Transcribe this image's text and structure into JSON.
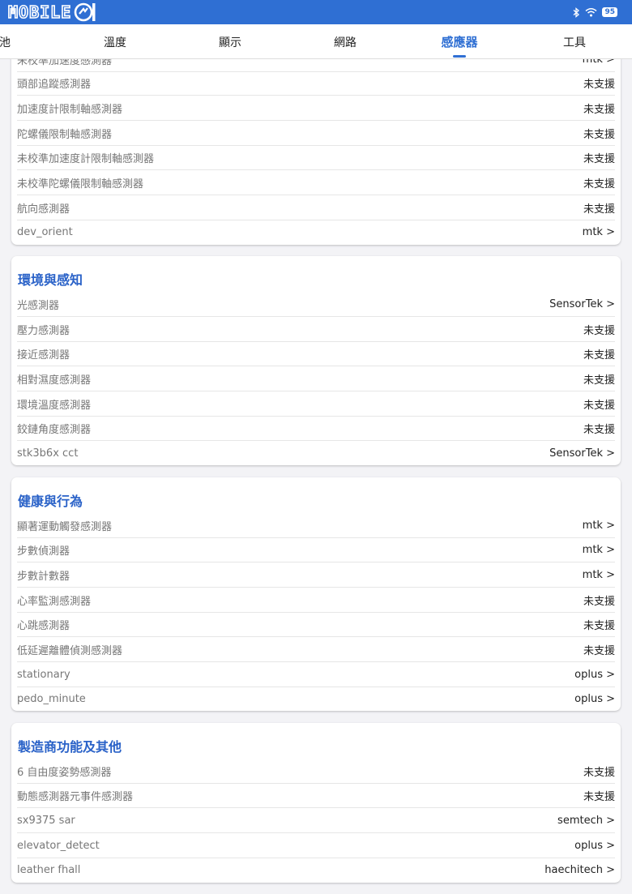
{
  "status_bar": {
    "logo_text": "MOBILE",
    "logo_mark": "01",
    "battery": "95",
    "icons": [
      "bluetooth-icon",
      "wifi-icon"
    ]
  },
  "tabs": [
    {
      "label": "池"
    },
    {
      "label": "溫度"
    },
    {
      "label": "顯示"
    },
    {
      "label": "網路"
    },
    {
      "label": "感應器",
      "active": true
    },
    {
      "label": "工具"
    }
  ],
  "card1": {
    "partial_label": "未校準加速度感測器",
    "partial_value": "mtk >",
    "items": [
      {
        "label": "頭部追蹤感測器",
        "value": "未支援"
      },
      {
        "label": "加速度計限制軸感測器",
        "value": "未支援"
      },
      {
        "label": "陀螺儀限制軸感測器",
        "value": "未支援"
      },
      {
        "label": "未校準加速度計限制軸感測器",
        "value": "未支援"
      },
      {
        "label": "未校準陀螺儀限制軸感測器",
        "value": "未支援"
      },
      {
        "label": "航向感測器",
        "value": "未支援"
      },
      {
        "label": "dev_orient",
        "value": "mtk >"
      }
    ]
  },
  "card2": {
    "title": "環境與感知",
    "items": [
      {
        "label": "光感測器",
        "value": "SensorTek >"
      },
      {
        "label": "壓力感測器",
        "value": "未支援"
      },
      {
        "label": "接近感測器",
        "value": "未支援"
      },
      {
        "label": "相對濕度感測器",
        "value": "未支援"
      },
      {
        "label": "環境溫度感測器",
        "value": "未支援"
      },
      {
        "label": "鉸鏈角度感測器",
        "value": "未支援"
      },
      {
        "label": "stk3b6x cct",
        "value": "SensorTek >"
      }
    ]
  },
  "card3": {
    "title": "健康與行為",
    "items": [
      {
        "label": "顯著運動觸發感測器",
        "value": "mtk >"
      },
      {
        "label": "步數偵測器",
        "value": "mtk >"
      },
      {
        "label": "步數計數器",
        "value": "mtk >"
      },
      {
        "label": "心率監測感測器",
        "value": "未支援"
      },
      {
        "label": "心跳感測器",
        "value": "未支援"
      },
      {
        "label": "低延遲離體偵測感測器",
        "value": "未支援"
      },
      {
        "label": "stationary",
        "value": "oplus >"
      },
      {
        "label": "pedo_minute",
        "value": "oplus >"
      }
    ]
  },
  "card4": {
    "title": "製造商功能及其他",
    "items": [
      {
        "label": "6 自由度姿勢感測器",
        "value": "未支援"
      },
      {
        "label": "動態感測器元事件感測器",
        "value": "未支援"
      },
      {
        "label": "sx9375 sar",
        "value": "semtech >"
      },
      {
        "label": "elevator_detect",
        "value": "oplus >"
      },
      {
        "label": "leather fhall",
        "value": "haechitech >"
      }
    ]
  },
  "colors": {
    "accent": "#2f6fd3",
    "section_title": "#2a62c8",
    "background": "#f3f3f6"
  }
}
